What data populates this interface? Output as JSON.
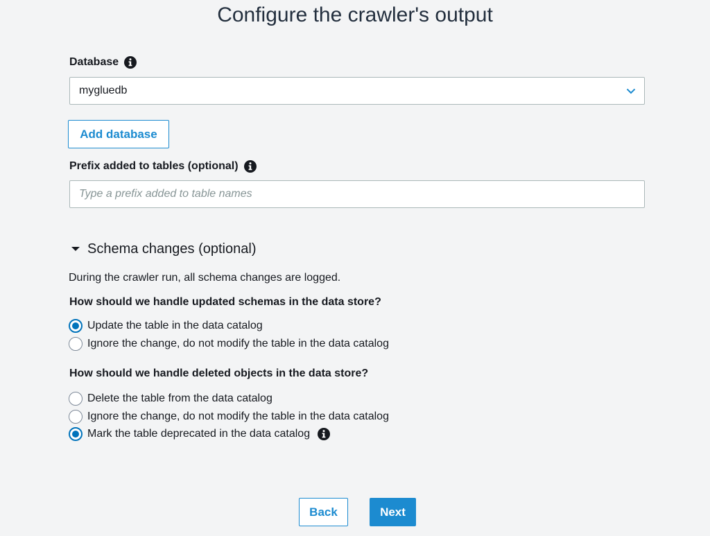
{
  "page": {
    "title": "Configure the crawler's output"
  },
  "database": {
    "label": "Database",
    "selected": "mygluedb",
    "add_button": "Add database"
  },
  "prefix": {
    "label": "Prefix added to tables (optional)",
    "value": "",
    "placeholder": "Type a prefix added to table names"
  },
  "schema_changes": {
    "title": "Schema changes (optional)",
    "description": "During the crawler run, all schema changes are logged.",
    "updated_question": "How should we handle updated schemas in the data store?",
    "updated_options": [
      {
        "label": "Update the table in the data catalog",
        "selected": true
      },
      {
        "label": "Ignore the change, do not modify the table in the data catalog",
        "selected": false
      }
    ],
    "deleted_question": "How should we handle deleted objects in the data store?",
    "deleted_options": [
      {
        "label": "Delete the table from the data catalog",
        "selected": false
      },
      {
        "label": "Ignore the change, do not modify the table in the data catalog",
        "selected": false
      },
      {
        "label": "Mark the table deprecated in the data catalog",
        "selected": true
      }
    ]
  },
  "footer": {
    "back_label": "Back",
    "next_label": "Next"
  },
  "colors": {
    "accent": "#1c8bd0",
    "radio_selected": "#0073bb",
    "background": "#f3f4f5"
  },
  "icons": {
    "info": "info-icon",
    "dropdown": "chevron-down-icon",
    "section_toggle": "caret-down-icon"
  }
}
